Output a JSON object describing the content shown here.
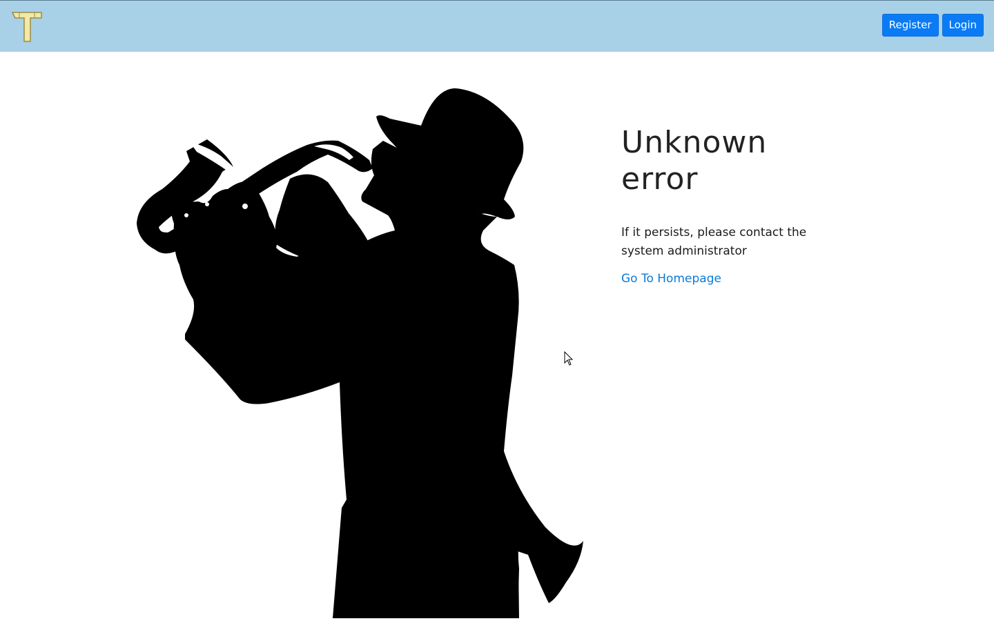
{
  "navbar": {
    "logo_icon": "hammer-logo-icon",
    "register_label": "Register",
    "login_label": "Login",
    "background_color": "#a8d0e6",
    "button_color": "#0a7bf5"
  },
  "illustration": {
    "icon": "saxophone-player-silhouette-icon"
  },
  "error": {
    "title": "Unknown error",
    "message": "If it persists, please contact the system administrator",
    "home_link": "Go To Homepage",
    "link_color": "#0a7bd6"
  }
}
